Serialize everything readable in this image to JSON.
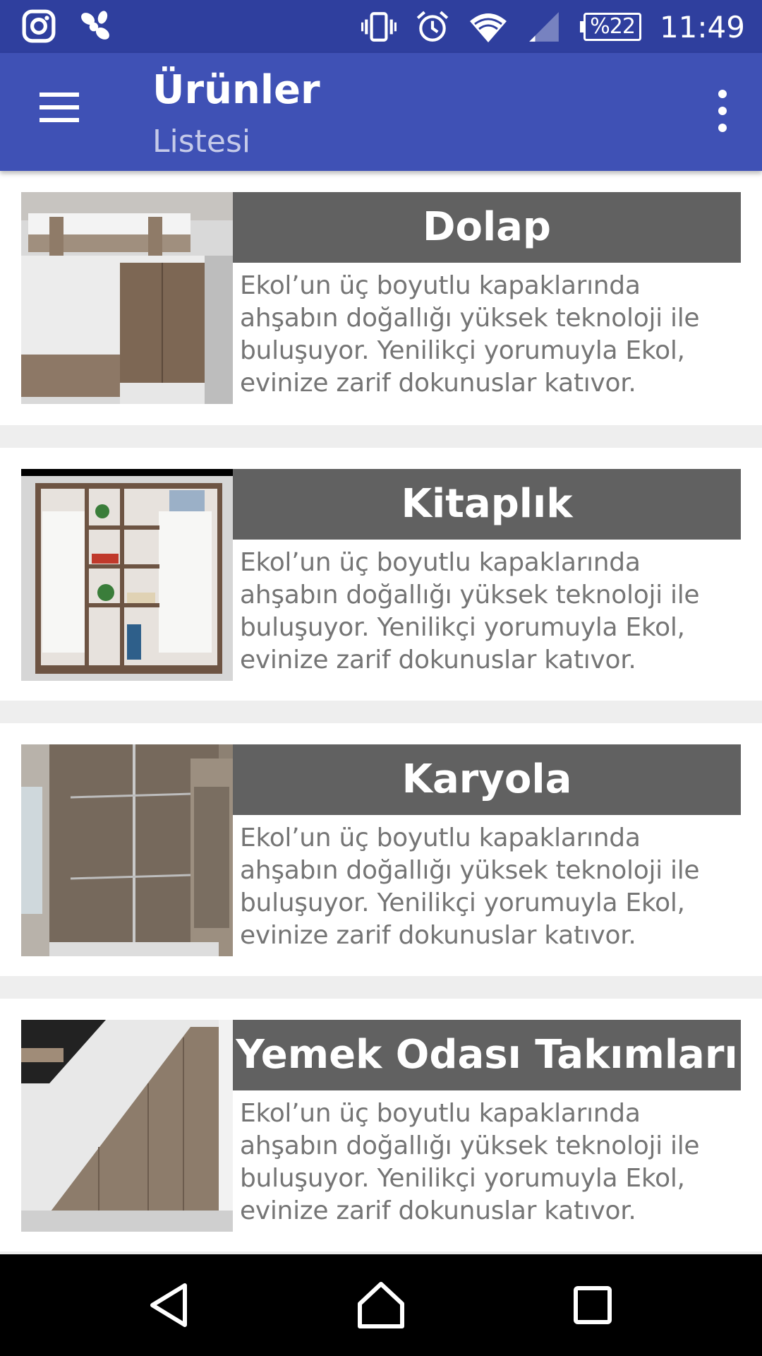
{
  "status_bar": {
    "battery_text": "%22",
    "time": "11:49",
    "icons": [
      "instagram-icon",
      "app-notification-icon",
      "vibrate-icon",
      "alarm-icon",
      "wifi-icon",
      "cellular-signal-icon",
      "battery-icon"
    ]
  },
  "app_bar": {
    "title": "Ürünler",
    "subtitle": "Listesi",
    "color": "#3f51b5"
  },
  "products": [
    {
      "name": "Dolap",
      "description": "Ekol’un üç boyutlu kapaklarında ahşabın doğallığı yüksek teknoloji ile buluşuyor. Yenilikçi yorumuyla Ekol, evinize zarif dokunuslar katıvor."
    },
    {
      "name": "Kitaplık",
      "description": "Ekol’un üç boyutlu kapaklarında ahşabın doğallığı yüksek teknoloji ile buluşuyor. Yenilikçi yorumuyla Ekol, evinize zarif dokunuslar katıvor."
    },
    {
      "name": "Karyola",
      "description": "Ekol’un üç boyutlu kapaklarında ahşabın doğallığı yüksek teknoloji ile buluşuyor. Yenilikçi yorumuyla Ekol, evinize zarif dokunuslar katıvor."
    },
    {
      "name": "Yemek Odası Takımları",
      "description": "Ekol’un üç boyutlu kapaklarında ahşabın doğallığı yüksek teknoloji ile buluşuyor. Yenilikçi yorumuyla Ekol, evinize zarif dokunuslar katıvor."
    }
  ],
  "nav_bar": {
    "icons": [
      "back-icon",
      "home-icon",
      "recents-icon"
    ]
  }
}
